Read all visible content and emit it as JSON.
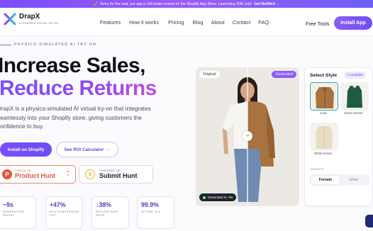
{
  "announcement": {
    "icon": "party-icon",
    "text": "Sorry for the wait, our app is still under review on the Shopify App Store. Launching 30th July!",
    "cta": "Get Notified →"
  },
  "brand": {
    "name": "DrapX",
    "tagline": "AI-POWERED VIRTUAL TRY-ON"
  },
  "nav": {
    "links": [
      "Features",
      "How it works",
      "Pricing",
      "Blog",
      "About",
      "Contact",
      "FAQ"
    ],
    "free_tools": "Free Tools",
    "install": "Install App"
  },
  "hero": {
    "eyebrow": "PHYSICS-SIMULATED AI TRY-ON",
    "headline_1": "Increase Sales,",
    "headline_2": "Reduce Returns",
    "description": "DrapX is a physics-simulated AI virtual try-on that integrates seamlessly into your Shopify store, giving customers the confidence to buy.",
    "cta_primary": "Install on Shopify",
    "cta_secondary": "See ROI Calculator",
    "cta_secondary_icon": "arrow-right-icon"
  },
  "badges": {
    "product_hunt": {
      "small": "FIND US ON",
      "big": "Product Hunt",
      "votes": "5"
    },
    "submit_hunt": {
      "small": "FEATURED ON",
      "big": "Submit Hunt"
    }
  },
  "stats": [
    {
      "value": "~9s",
      "label": "GENERATION SPEED"
    },
    {
      "value": "+47%",
      "label": "AVG CONVERSION LIFT"
    },
    {
      "value": "↓38%",
      "label": "RETURN RATE DROP"
    },
    {
      "value": "99.9%",
      "label": "UPTIME SLA"
    }
  ],
  "demo": {
    "original_tag": "Original",
    "generated_tag": "Generated",
    "generated_pill": "Generated in ~9s"
  },
  "style_panel": {
    "title": "Select Style",
    "available": "3 Available",
    "items": [
      {
        "label": "Coat",
        "color": "#a9733f"
      },
      {
        "label": "Green Dress",
        "color": "#1f5a45"
      },
      {
        "label": "White Dress",
        "color": "#e9dcc4"
      }
    ],
    "gender_label": "GENDER",
    "gender_options": [
      "Female",
      "Male"
    ],
    "gender_selected": "Female"
  },
  "colors": {
    "accent": "#6d4ff5",
    "product_hunt": "#e4563b"
  }
}
